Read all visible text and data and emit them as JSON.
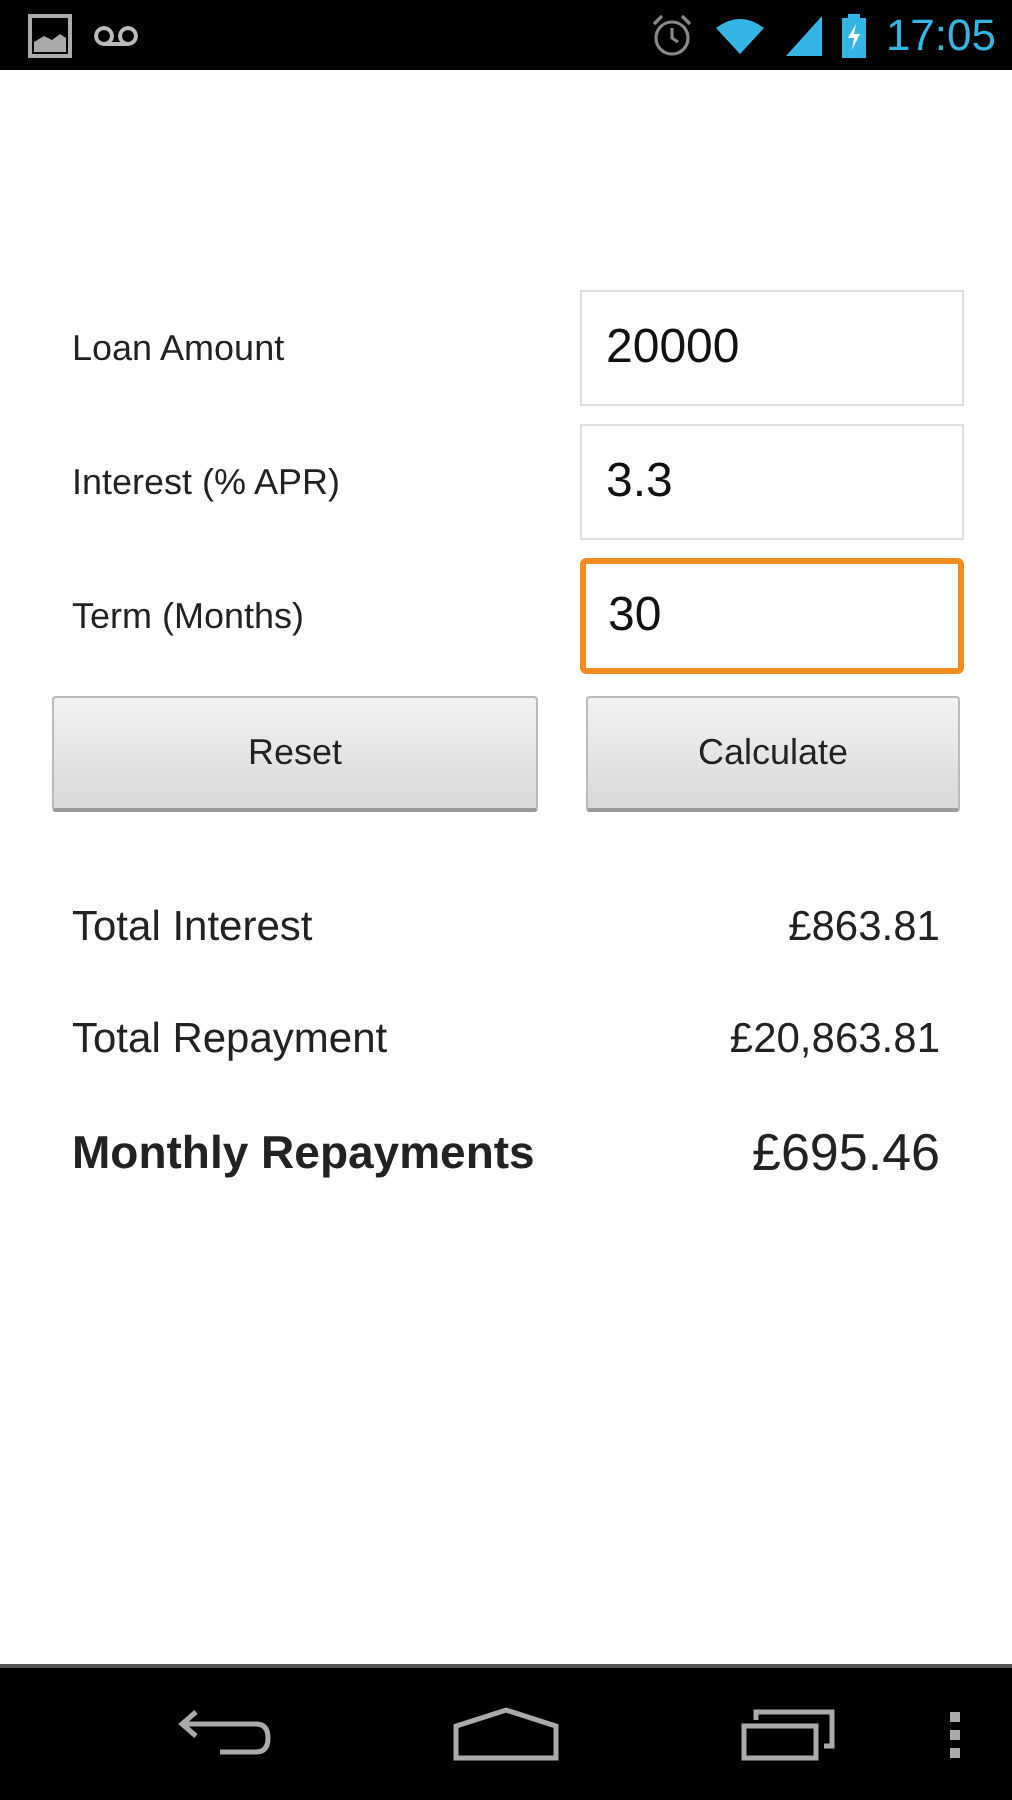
{
  "status_bar": {
    "time": "17:05"
  },
  "fields": [
    {
      "label": "Loan Amount",
      "value": "20000",
      "focused": false
    },
    {
      "label": "Interest (% APR)",
      "value": "3.3",
      "focused": false
    },
    {
      "label": "Term (Months)",
      "value": "30",
      "focused": true
    }
  ],
  "buttons": [
    "Reset",
    "Calculate"
  ],
  "results": [
    {
      "label": "Total Interest",
      "value": "£863.81",
      "emphasis": false
    },
    {
      "label": "Total Repayment",
      "value": "£20,863.81",
      "emphasis": false
    },
    {
      "label": "Monthly Repayments",
      "value": "£695.46",
      "emphasis": true
    }
  ]
}
